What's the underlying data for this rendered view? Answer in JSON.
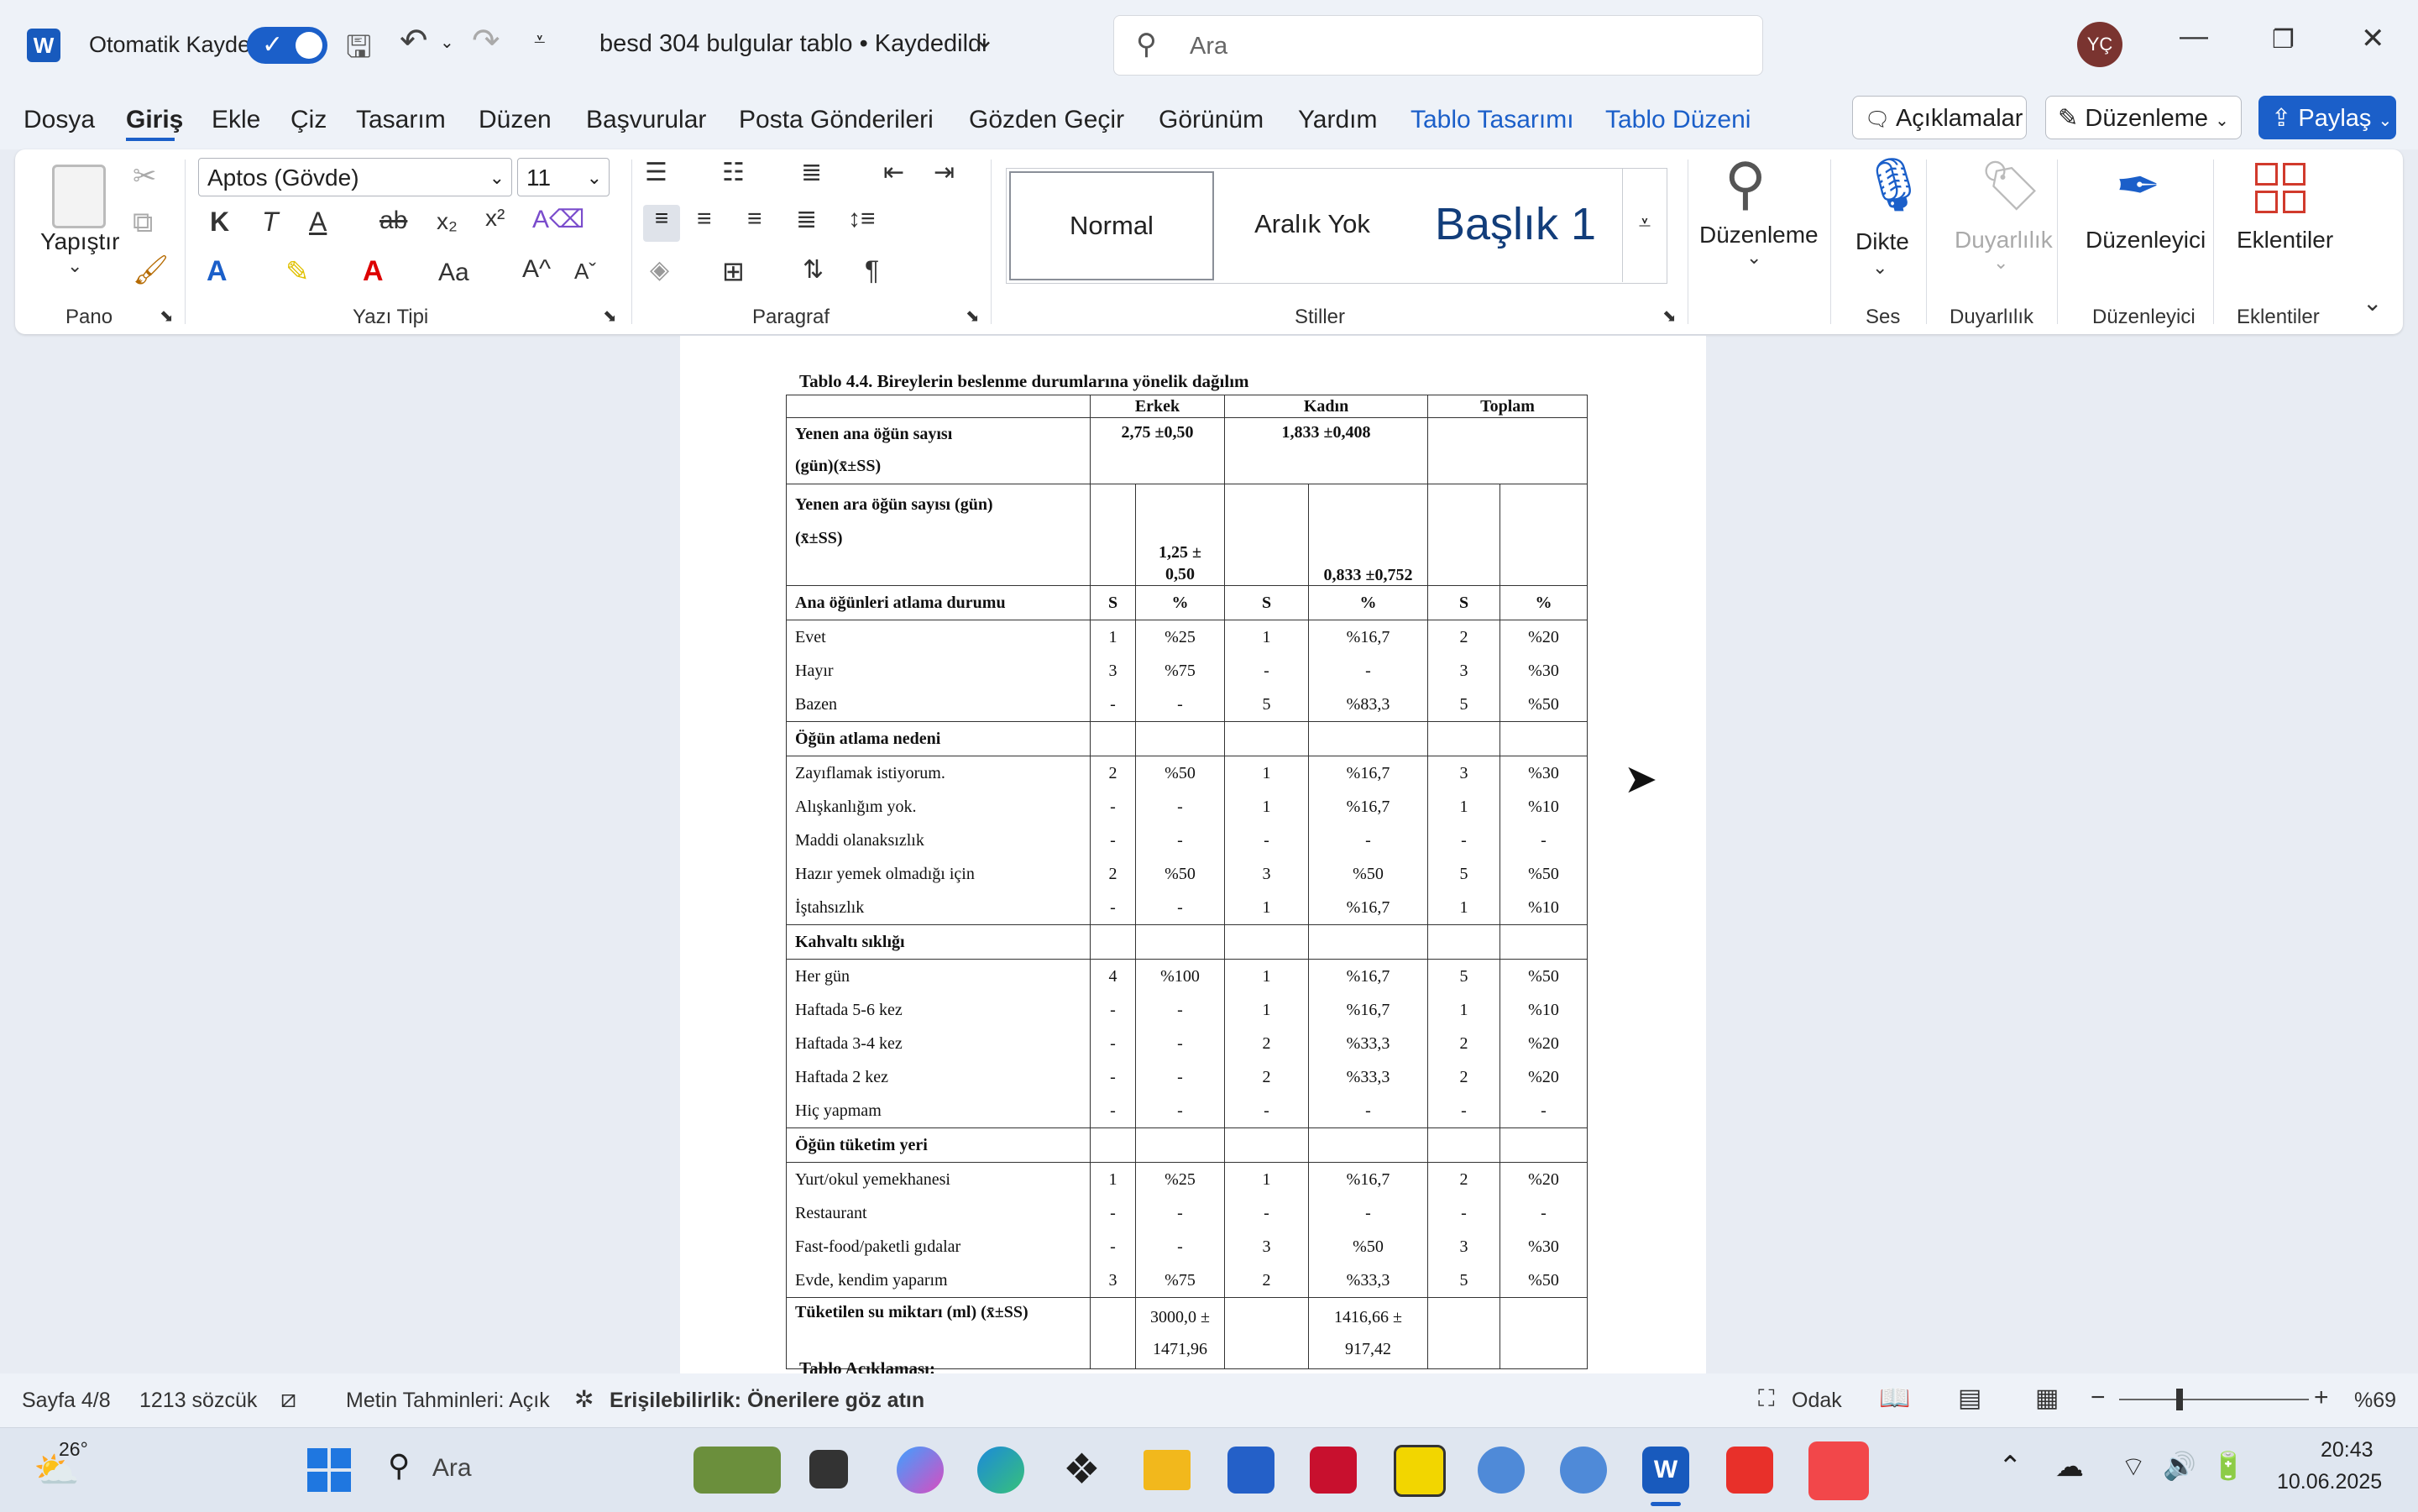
{
  "titlebar": {
    "app_icon": "word-icon",
    "autosave_label": "Otomatik Kaydet",
    "doc_title": "besd 304 bulgular tablo • Kaydedildi",
    "search_placeholder": "Ara",
    "avatar_initials": "YÇ"
  },
  "menu": {
    "items": [
      "Dosya",
      "Giriş",
      "Ekle",
      "Çiz",
      "Tasarım",
      "Düzen",
      "Başvurular",
      "Posta Gönderileri",
      "Gözden Geçir",
      "Görünüm",
      "Yardım",
      "Tablo Tasarımı",
      "Tablo Düzeni"
    ],
    "comments_label": "Açıklamalar",
    "editing_label": "Düzenleme",
    "share_label": "Paylaş"
  },
  "ribbon": {
    "paste_label": "Yapıştır",
    "group_clipboard": "Pano",
    "font_name": "Aptos (Gövde)",
    "font_size": "11",
    "group_font": "Yazı Tipi",
    "group_paragraph": "Paragraf",
    "styles": [
      "Normal",
      "Aralık Yok",
      "Başlık 1"
    ],
    "group_styles": "Stiller",
    "editing_big": "Düzenleme",
    "dictate": "Dikte",
    "group_voice": "Ses",
    "sensitivity": "Duyarlılık",
    "group_sensitivity": "Duyarlılık",
    "editor": "Düzenleyici",
    "group_editor": "Düzenleyici",
    "addins": "Eklentiler",
    "group_addins": "Eklentiler",
    "font_btn_bold": "K",
    "font_btn_italic": "T",
    "font_btn_underline": "A"
  },
  "document": {
    "caption": "Tablo 4.4. Bireylerin beslenme durumlarına yönelik dağılım",
    "header": [
      "",
      "Erkek",
      "Kadın",
      "Toplam"
    ],
    "mean1_label_a": "Yenen ana öğün sayısı",
    "mean1_label_b": "(gün)(x̄±SS)",
    "mean1_m": "2,75 ±0,50",
    "mean1_f": "1,833 ±0,408",
    "mean2_label_a": "Yenen ara öğün sayısı (gün)",
    "mean2_label_b": "(x̄±SS)",
    "mean2_m_a": "1,25 ±",
    "mean2_m_b": "0,50",
    "mean2_f": "0,833 ±0,752",
    "sections": [
      {
        "title": "Ana öğünleri atlama durumu",
        "sub": [
          "S",
          "%",
          "S",
          "%",
          "S",
          "%"
        ],
        "rows": [
          [
            "Evet",
            "1",
            "%25",
            "1",
            "%16,7",
            "2",
            "%20"
          ],
          [
            "Hayır",
            "3",
            "%75",
            "-",
            "-",
            "3",
            "%30"
          ],
          [
            "Bazen",
            "-",
            "-",
            "5",
            "%83,3",
            "5",
            "%50"
          ]
        ]
      },
      {
        "title": "Öğün atlama nedeni",
        "rows": [
          [
            "Zayıflamak istiyorum.",
            "2",
            "%50",
            "1",
            "%16,7",
            "3",
            "%30"
          ],
          [
            "Alışkanlığım yok.",
            "-",
            "-",
            "1",
            "%16,7",
            "1",
            "%10"
          ],
          [
            "Maddi olanaksızlık",
            "-",
            "-",
            "-",
            "-",
            "-",
            "-"
          ],
          [
            "Hazır yemek olmadığı için",
            "2",
            "%50",
            "3",
            "%50",
            "5",
            "%50"
          ],
          [
            "İştahsızlık",
            "-",
            "-",
            "1",
            "%16,7",
            "1",
            "%10"
          ]
        ]
      },
      {
        "title": "Kahvaltı sıklığı",
        "rows": [
          [
            "Her gün",
            "4",
            "%100",
            "1",
            "%16,7",
            "5",
            "%50"
          ],
          [
            "Haftada 5-6 kez",
            "-",
            "-",
            "1",
            "%16,7",
            "1",
            "%10"
          ],
          [
            "Haftada 3-4 kez",
            "-",
            "-",
            "2",
            "%33,3",
            "2",
            "%20"
          ],
          [
            "Haftada 2 kez",
            "-",
            "-",
            "2",
            "%33,3",
            "2",
            "%20"
          ],
          [
            "Hiç yapmam",
            "-",
            "-",
            "-",
            "-",
            "-",
            "-"
          ]
        ]
      },
      {
        "title": "Öğün tüketim yeri",
        "rows": [
          [
            "Yurt/okul yemekhanesi",
            "1",
            "%25",
            "1",
            "%16,7",
            "2",
            "%20"
          ],
          [
            "Restaurant",
            "-",
            "-",
            "-",
            "-",
            "-",
            "-"
          ],
          [
            "Fast-food/paketli gıdalar",
            "-",
            "-",
            "3",
            "%50",
            "3",
            "%30"
          ],
          [
            "Evde, kendim yaparım",
            "3",
            "%75",
            "2",
            "%33,3",
            "5",
            "%50"
          ]
        ]
      }
    ],
    "water_label": "Tüketilen su miktarı (ml) (x̄±SS)",
    "water_m_a": "3000,0 ±",
    "water_m_b": "1471,96",
    "water_f_a": "1416,66 ±",
    "water_f_b": "917,42",
    "footer_caption": "Tablo Açıklaması:"
  },
  "status": {
    "page": "Sayfa 4/8",
    "words": "1213 sözcük",
    "predictions": "Metin Tahminleri: Açık",
    "accessibility": "Erişilebilirlik: Önerilere göz atın",
    "focus": "Odak",
    "zoom": "%69"
  },
  "taskbar": {
    "weather": "26°",
    "search": "Ara",
    "time": "20:43",
    "date": "10.06.2025"
  }
}
